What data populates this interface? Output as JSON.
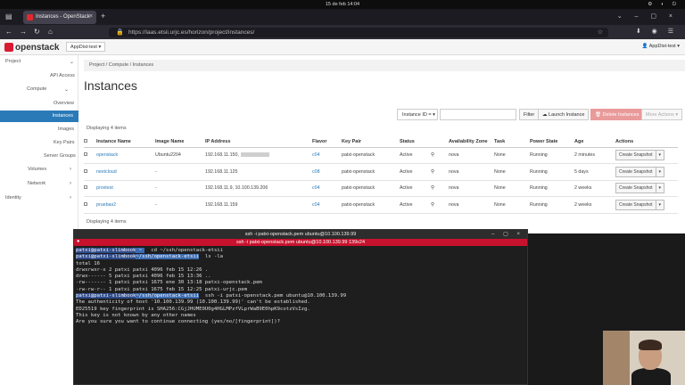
{
  "system": {
    "clock": "15 de feb  14:04"
  },
  "browser": {
    "tab_title": "Instances - OpenStack",
    "url": "https://iaas.etsii.urjc.es/horizon/project/instances/"
  },
  "header": {
    "logo_text": "openstack",
    "project_selector": "AppDist-test ▾",
    "user_menu": "AppDist-test ▾"
  },
  "sidebar": {
    "project": "Project",
    "api_access": "API Access",
    "compute": "Compute",
    "overview": "Overview",
    "instances": "Instances",
    "images": "Images",
    "key_pairs": "Key Pairs",
    "server_groups": "Server Groups",
    "volumes": "Volumes",
    "network": "Network",
    "identity": "Identity"
  },
  "breadcrumb": {
    "project": "Project",
    "compute": "Compute",
    "instances": "Instances",
    "sep": "/"
  },
  "page_title": "Instances",
  "toolbar": {
    "filter_select": "Instance ID = ▾",
    "filter_btn": "Filter",
    "launch_btn": "Launch Instance",
    "delete_btn": "Delete Instances",
    "more_btn": "More Actions ▾"
  },
  "displaying": "Displaying 4 items",
  "table": {
    "headers": [
      "Instance Name",
      "Image Name",
      "IP Address",
      "Flavor",
      "Key Pair",
      "Status",
      "Availability Zone",
      "Task",
      "Power State",
      "Age",
      "Actions"
    ],
    "rows": [
      {
        "name": "openstack",
        "image": "Ubuntu2204",
        "ip": "192.168.11.150,",
        "flavor": "c04",
        "keypair": "patxi-openstack",
        "status": "Active",
        "zone": "nova",
        "task": "None",
        "power": "Running",
        "age": "2 minutes",
        "action": "Create Snapshot"
      },
      {
        "name": "nextcloud",
        "image": "-",
        "ip": "192.168.11.125",
        "flavor": "c08",
        "keypair": "patxi-openstack",
        "status": "Active",
        "zone": "nova",
        "task": "None",
        "power": "Running",
        "age": "5 days",
        "action": "Create Snapshot"
      },
      {
        "name": "proxtest",
        "image": "-",
        "ip": "192.168.11.9, 10.100.139.206",
        "flavor": "c04",
        "keypair": "patxi-openstack",
        "status": "Active",
        "zone": "nova",
        "task": "None",
        "power": "Running",
        "age": "2 weeks",
        "action": "Create Snapshot"
      },
      {
        "name": "pruebas2",
        "image": "-",
        "ip": "192.168.11.159",
        "flavor": "c04",
        "keypair": "patxi-openstack",
        "status": "Active",
        "zone": "nova",
        "task": "None",
        "power": "Running",
        "age": "2 weeks",
        "action": "Create Snapshot"
      }
    ]
  },
  "terminal": {
    "window_title": "ssh -i patxi-openstack.pem ubuntu@10.100.139.99",
    "tab_title": "ssh -i patxi-openstack.pem ubuntu@10.100.139.99 139x24",
    "prompt_user": "patxi@patxi-slimbook",
    "cmd1": "cd ~/ssh/openstack-etsii",
    "prompt_path": "~/ssh/openstack-etsii",
    "cmd2": "ls -la",
    "out1": "total 16",
    "out2": "drwxrwxr-x 2 patxi patxi 4096 feb 15 12:26 .",
    "out3": "drwx------ 5 patxi patxi 4096 feb 15 13:36 ..",
    "out4": "-rw------- 1 patxi patxi 1675 ene 30 13:18 patxi-openstack.pem",
    "out5": "-rw-rw-r-- 1 patxi patxi 1675 feb 15 12:25 patxi-urjc.pem",
    "cmd3": "ssh -i patxi-openstack.pem ubuntu@10.100.139.99",
    "out6": "The authenticity of host '10.100.139.99 (10.100.139.99)' can't be established.",
    "out7": "ED25519 key fingerprint is SHA256:CGjJHUME0U0g4HGLMPzfVLprWaB9E0hpK9cotzVsIzg.",
    "out8": "This key is not known by any other names",
    "out9": "Are you sure you want to continue connecting (yes/no/[fingerprint])?"
  }
}
